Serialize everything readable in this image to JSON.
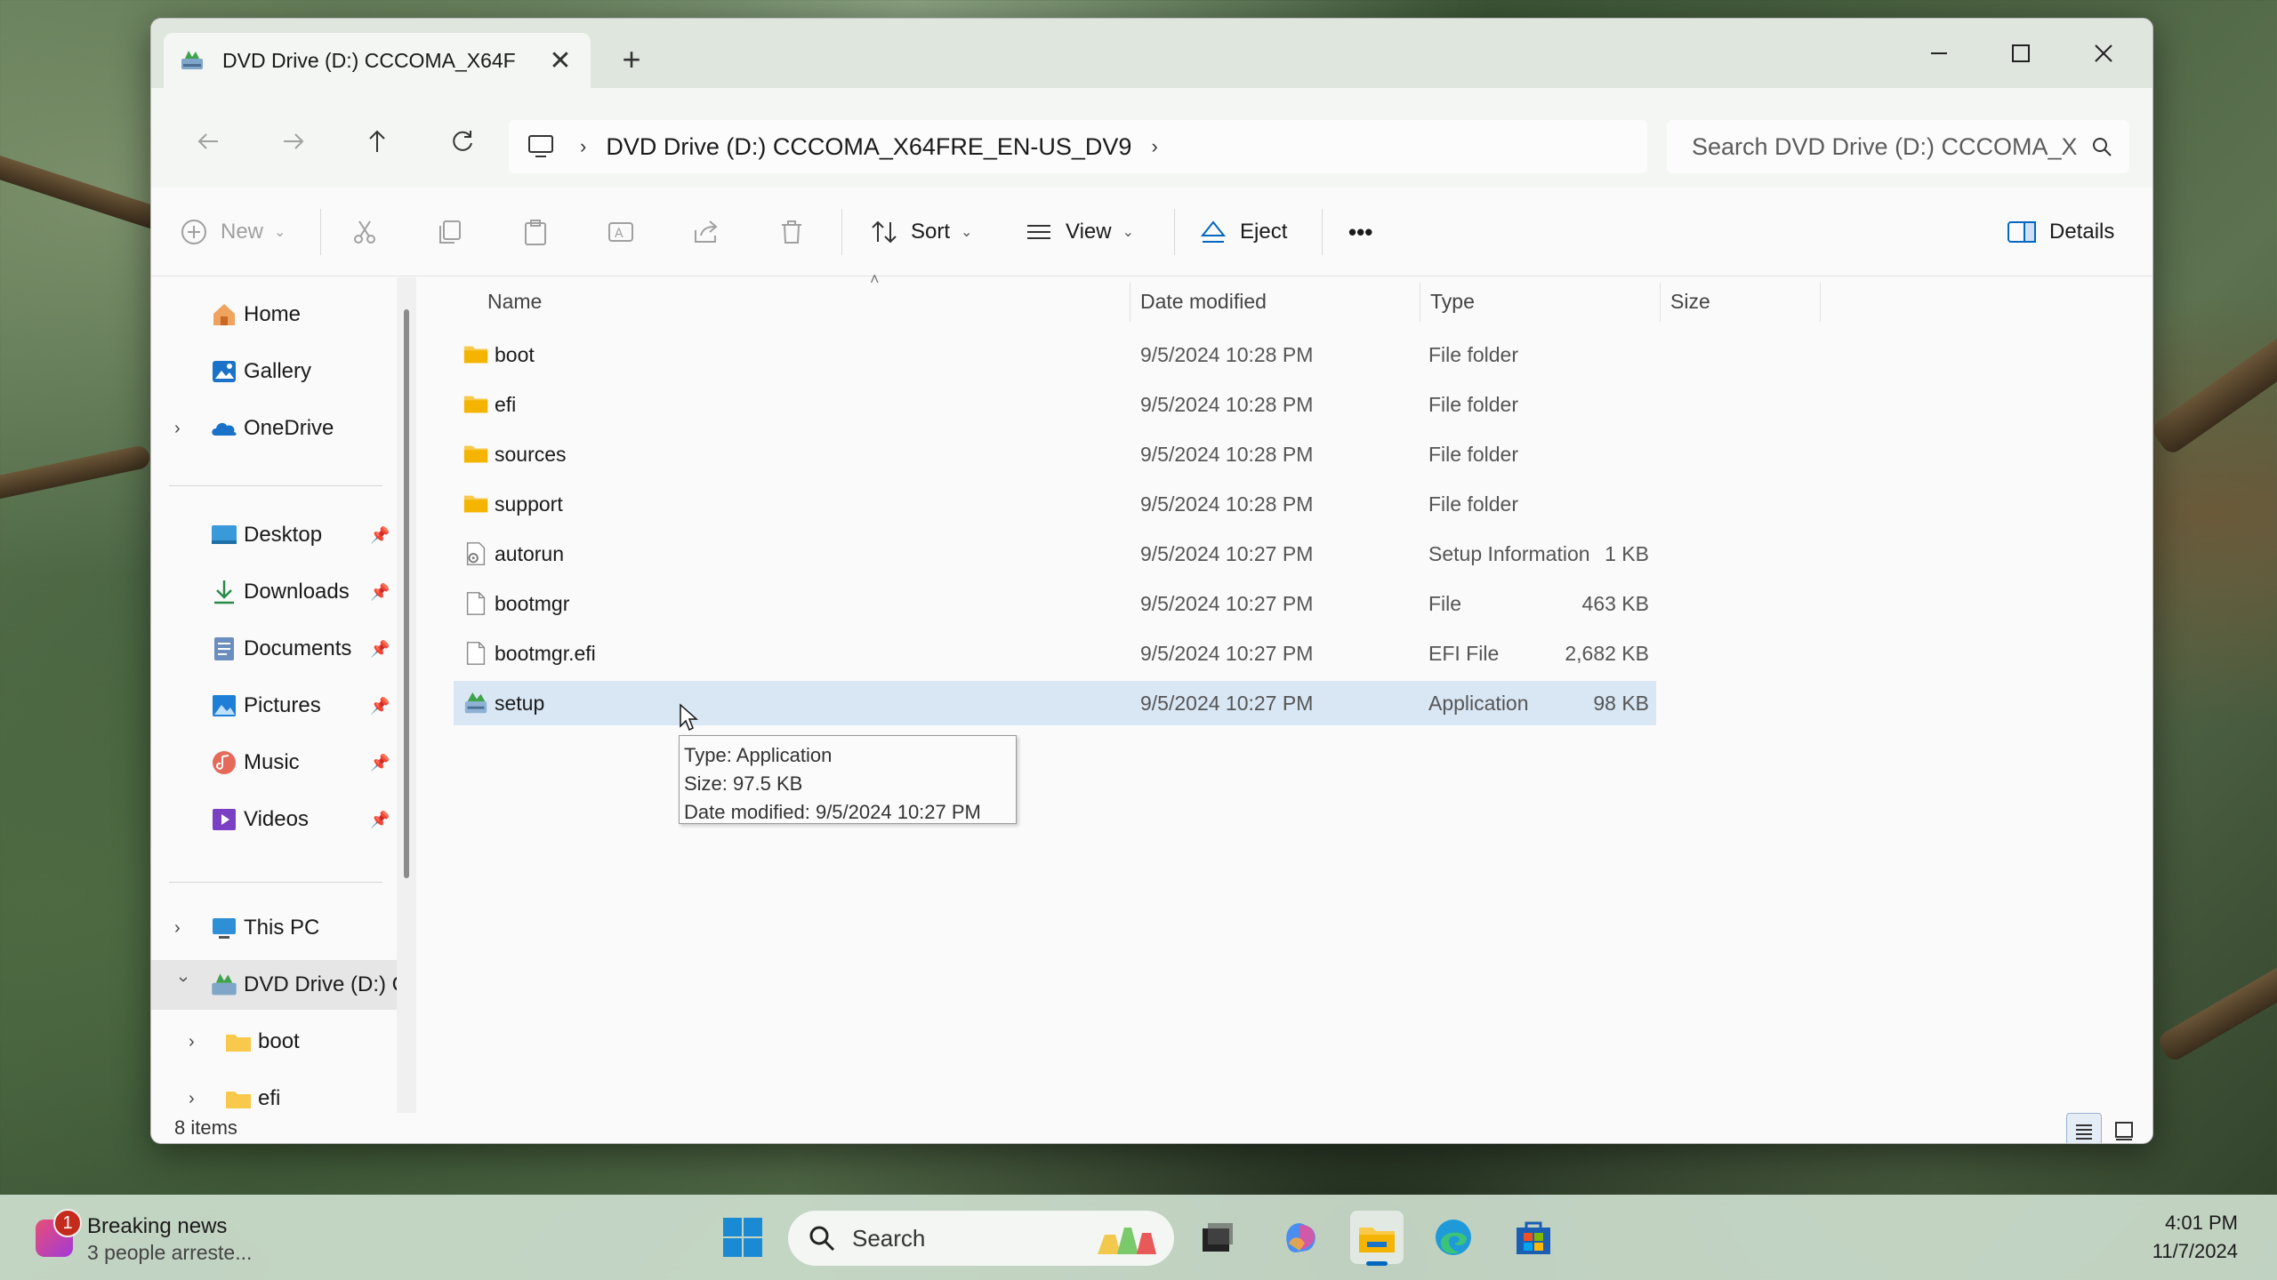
{
  "window": {
    "tab_title": "DVD Drive (D:) CCCOMA_X64F",
    "new_tab": "+",
    "close_tab": "✕"
  },
  "address": {
    "crumb": "DVD Drive (D:) CCCOMA_X64FRE_EN-US_DV9",
    "search_placeholder": "Search DVD Drive (D:) CCCOMA_X"
  },
  "toolbar": {
    "new": "New",
    "sort": "Sort",
    "view": "View",
    "eject": "Eject",
    "more": "•••",
    "details": "Details"
  },
  "sidebar": {
    "home": "Home",
    "gallery": "Gallery",
    "onedrive": "OneDrive",
    "desktop": "Desktop",
    "downloads": "Downloads",
    "documents": "Documents",
    "pictures": "Pictures",
    "music": "Music",
    "videos": "Videos",
    "thispc": "This PC",
    "dvd": "DVD Drive (D:) C",
    "boot": "boot",
    "efi": "efi"
  },
  "columns": {
    "name": "Name",
    "date": "Date modified",
    "type": "Type",
    "size": "Size"
  },
  "files": [
    {
      "name": "boot",
      "date": "9/5/2024 10:28 PM",
      "type": "File folder",
      "size": "",
      "icon": "folder-icon"
    },
    {
      "name": "efi",
      "date": "9/5/2024 10:28 PM",
      "type": "File folder",
      "size": "",
      "icon": "folder-icon"
    },
    {
      "name": "sources",
      "date": "9/5/2024 10:28 PM",
      "type": "File folder",
      "size": "",
      "icon": "folder-icon"
    },
    {
      "name": "support",
      "date": "9/5/2024 10:28 PM",
      "type": "File folder",
      "size": "",
      "icon": "folder-icon"
    },
    {
      "name": "autorun",
      "date": "9/5/2024 10:27 PM",
      "type": "Setup Information",
      "size": "1 KB",
      "icon": "setup-info-icon"
    },
    {
      "name": "bootmgr",
      "date": "9/5/2024 10:27 PM",
      "type": "File",
      "size": "463 KB",
      "icon": "file-icon"
    },
    {
      "name": "bootmgr.efi",
      "date": "9/5/2024 10:27 PM",
      "type": "EFI File",
      "size": "2,682 KB",
      "icon": "file-icon"
    },
    {
      "name": "setup",
      "date": "9/5/2024 10:27 PM",
      "type": "Application",
      "size": "98 KB",
      "icon": "setup-app-icon"
    }
  ],
  "tooltip": {
    "type": "Type: Application",
    "size": "Size: 97.5 KB",
    "date": "Date modified: 9/5/2024 10:27 PM"
  },
  "status": {
    "count": "8 items"
  },
  "taskbar": {
    "news_badge": "1",
    "news_title": "Breaking news",
    "news_sub": "3 people arreste...",
    "search_label": "Search",
    "time": "4:01 PM",
    "date": "11/7/2024"
  },
  "colors": {
    "accent": "#0067c0",
    "selection": "#d9e7f5",
    "folder": "#f8c94a"
  }
}
